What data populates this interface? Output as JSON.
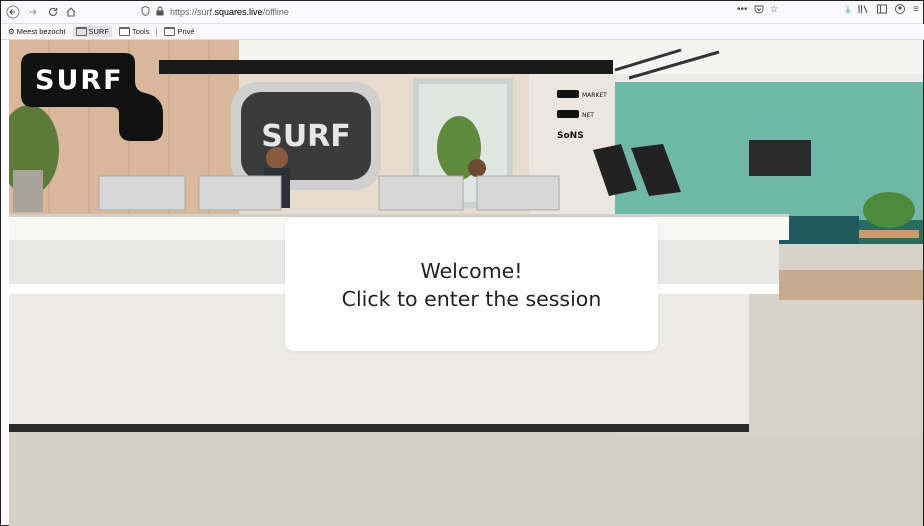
{
  "browser": {
    "url_prefix": "https://surf.",
    "url_host": "squares.live",
    "url_path": "/offline"
  },
  "icons": {
    "back": "back-icon",
    "forward": "forward-icon",
    "reload": "reload-icon",
    "home": "home-icon",
    "shield": "shield-icon",
    "lock": "lock-icon",
    "more": "more-icon",
    "bookmark_star": "star-icon",
    "download": "download-icon",
    "library": "library-icon",
    "sidebar": "sidebar-icon",
    "account": "account-icon",
    "menu": "menu-icon"
  },
  "bookmarks": [
    {
      "label": "Meest bezocht",
      "icon": "gear-icon"
    },
    {
      "label": "SURF",
      "icon": "folder-icon"
    },
    {
      "label": "Tools",
      "icon": "folder-icon"
    },
    {
      "label": "Privé",
      "icon": "folder-icon"
    }
  ],
  "page": {
    "logo": "SURF",
    "lobby_sign": "SURF",
    "wall_signs": [
      "SURF MARKET",
      "SURF NET",
      "SoNS"
    ],
    "welcome_line1": "Welcome!",
    "welcome_line2": "Click to enter the session"
  },
  "colors": {
    "accent_download": "#2a7fd4",
    "wall_teal": "#6fb7a6",
    "desk_white": "#f2f2f0",
    "floor": "#d6d1c6",
    "logo_black": "#111111"
  }
}
